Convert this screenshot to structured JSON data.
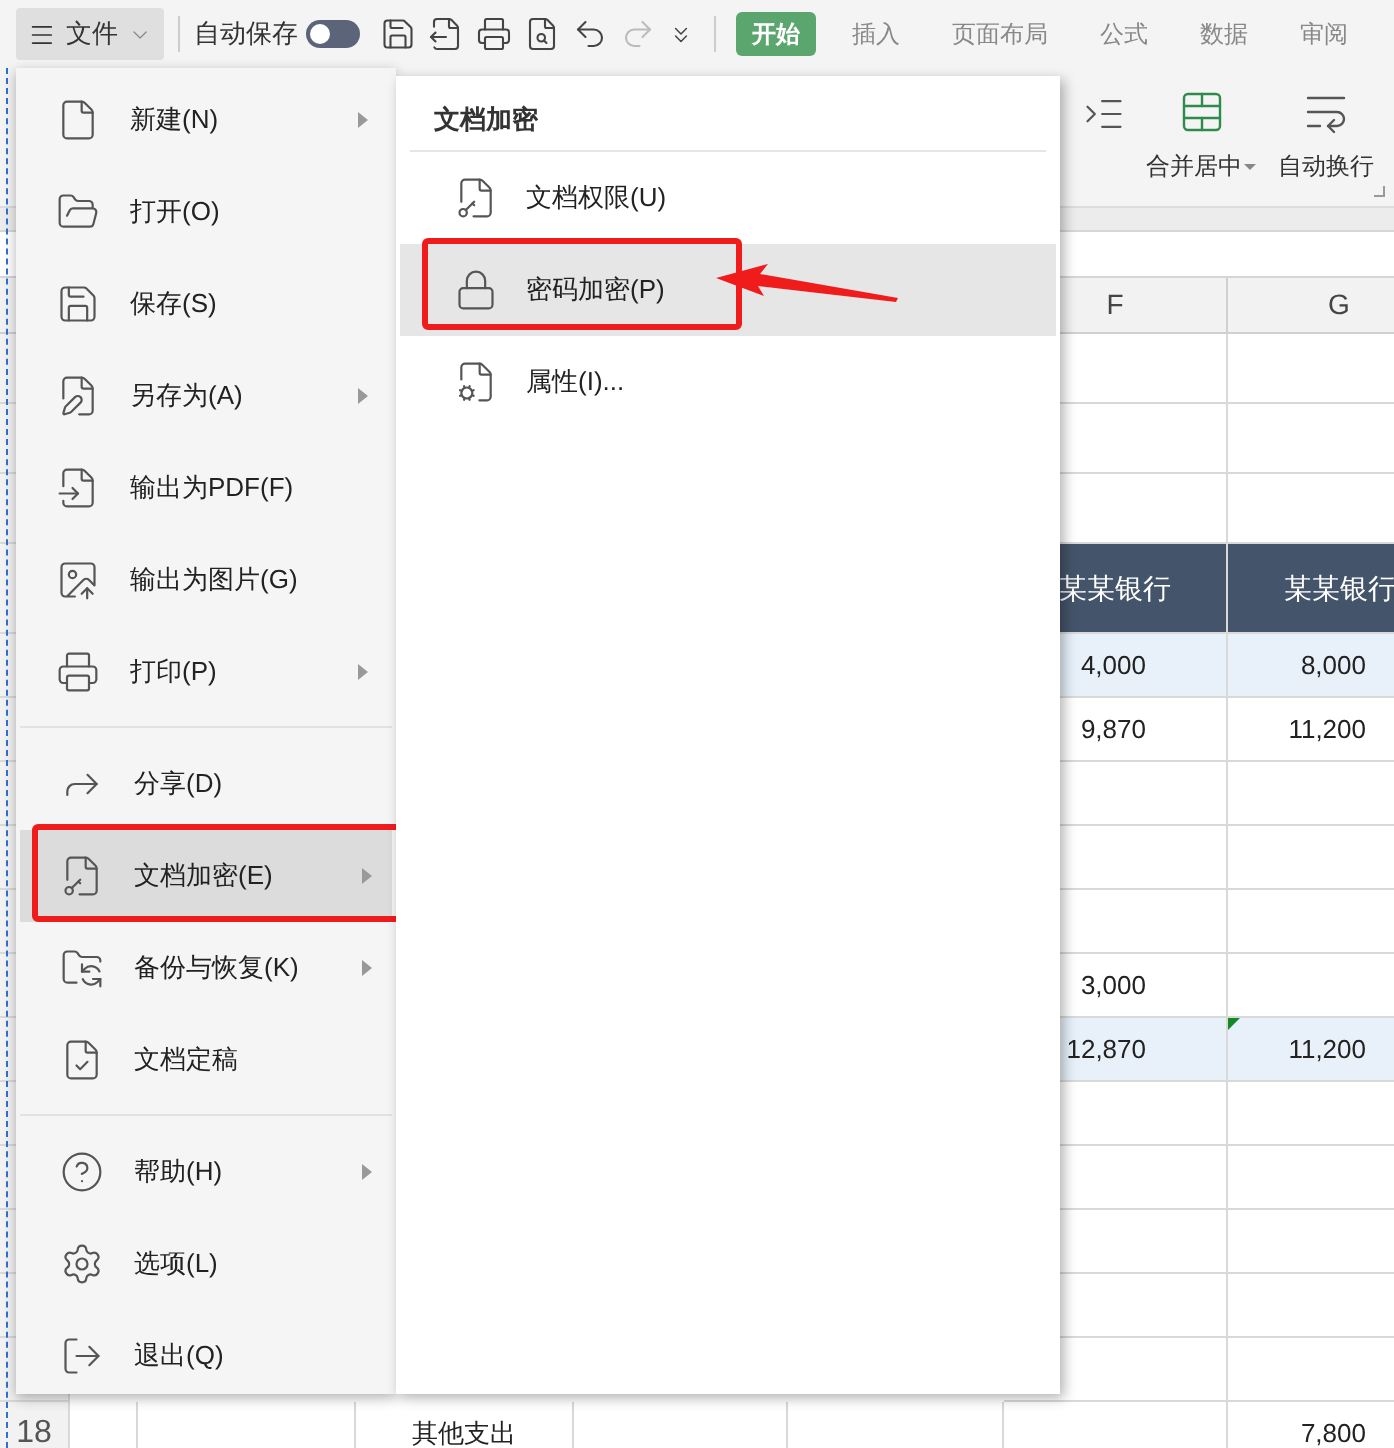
{
  "toolbar": {
    "file_button": "文件",
    "autosave_label": "自动保存",
    "autosave_on": false,
    "tabs": [
      {
        "label": "开始",
        "selected": true
      },
      {
        "label": "插入",
        "selected": false
      },
      {
        "label": "页面布局",
        "selected": false
      },
      {
        "label": "公式",
        "selected": false
      },
      {
        "label": "数据",
        "selected": false
      },
      {
        "label": "审阅",
        "selected": false
      }
    ]
  },
  "ribbon": {
    "buttons": [
      {
        "label": "合并居中",
        "dropdown": true
      },
      {
        "label": "自动换行",
        "dropdown": false
      }
    ]
  },
  "sheet": {
    "columns": [
      "F",
      "G"
    ],
    "rows": [
      {
        "kind": "blank"
      },
      {
        "kind": "blank"
      },
      {
        "kind": "blank"
      },
      {
        "kind": "header",
        "f": "某某银行",
        "g": "某某银行"
      },
      {
        "kind": "data",
        "highlighted": true,
        "f": "4,000",
        "g": "8,000"
      },
      {
        "kind": "data",
        "highlighted": false,
        "f": "9,870",
        "g": "11,200"
      },
      {
        "kind": "blank"
      },
      {
        "kind": "blank"
      },
      {
        "kind": "blank"
      },
      {
        "kind": "data",
        "highlighted": false,
        "f": "3,000"
      },
      {
        "kind": "data",
        "highlighted": true,
        "f": "12,870",
        "g": "11,200",
        "g_flag": true
      },
      {
        "kind": "blank"
      },
      {
        "kind": "blank"
      },
      {
        "kind": "blank"
      },
      {
        "kind": "blank"
      },
      {
        "kind": "blank"
      },
      {
        "kind": "data",
        "highlighted": false,
        "number": "18",
        "c": "其他支出",
        "g": "7,800"
      }
    ]
  },
  "file_menu": {
    "groups": [
      [
        {
          "label": "新建(N)",
          "submenu": true,
          "selected": false,
          "annotated": false
        },
        {
          "label": "打开(O)",
          "submenu": false,
          "selected": false,
          "annotated": false
        },
        {
          "label": "保存(S)",
          "submenu": false,
          "selected": false,
          "annotated": false
        },
        {
          "label": "另存为(A)",
          "submenu": true,
          "selected": false,
          "annotated": false
        },
        {
          "label": "输出为PDF(F)",
          "submenu": false,
          "selected": false,
          "annotated": false
        },
        {
          "label": "输出为图片(G)",
          "submenu": false,
          "selected": false,
          "annotated": false
        },
        {
          "label": "打印(P)",
          "submenu": true,
          "selected": false,
          "annotated": false
        }
      ],
      [
        {
          "label": "分享(D)",
          "submenu": false,
          "selected": false,
          "annotated": false
        },
        {
          "label": "文档加密(E)",
          "submenu": true,
          "selected": true,
          "annotated": true
        },
        {
          "label": "备份与恢复(K)",
          "submenu": true,
          "selected": false,
          "annotated": false
        },
        {
          "label": "文档定稿",
          "submenu": false,
          "selected": false,
          "annotated": false
        }
      ],
      [
        {
          "label": "帮助(H)",
          "submenu": true,
          "selected": false,
          "annotated": false
        },
        {
          "label": "选项(L)",
          "submenu": false,
          "selected": false,
          "annotated": false
        },
        {
          "label": "退出(Q)",
          "submenu": false,
          "selected": false,
          "annotated": false
        }
      ]
    ]
  },
  "submenu": {
    "title": "文档加密",
    "items": [
      {
        "label": "文档权限(U)",
        "selected": false,
        "annotated": false
      },
      {
        "label": "密码加密(P)",
        "selected": true,
        "annotated": true
      },
      {
        "label": "属性(I)...",
        "selected": false,
        "annotated": false
      }
    ]
  }
}
